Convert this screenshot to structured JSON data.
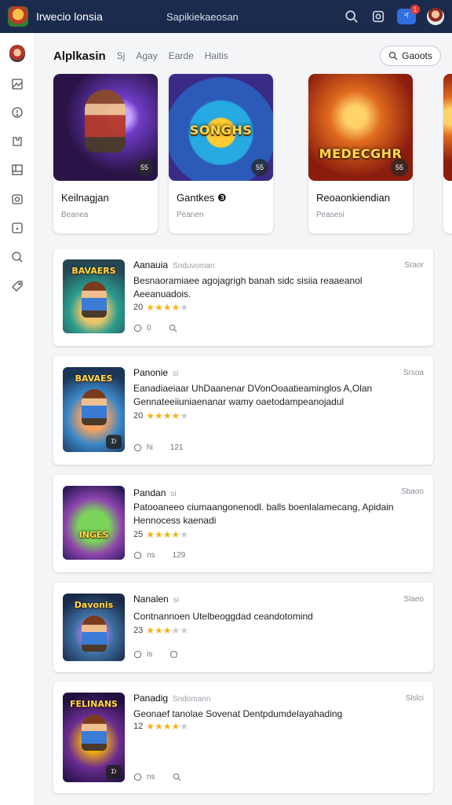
{
  "header": {
    "app_title": "Irwecio lonsia",
    "search_text": "Sapikiekaeosan",
    "notification_label": "ণ",
    "notification_count": "1"
  },
  "sidebar": {
    "items": [
      "profile",
      "image-icon",
      "alert-icon",
      "puzzle-icon",
      "layout-icon",
      "camera-icon",
      "help-icon",
      "search-icon",
      "tag-icon"
    ]
  },
  "tabs": [
    "Alplkasin",
    "Sj",
    "Agay",
    "Earde",
    "Haitis"
  ],
  "filter_button": "Gaoots",
  "featured": [
    {
      "name": "Keilnagjan",
      "sub": "Beanea",
      "badge": "55"
    },
    {
      "name": "Gantkes ❸",
      "sub": "Peanen",
      "art_title": "SONGHS",
      "badge": "55"
    },
    {
      "name": "Reoaonkiendian",
      "sub": "Peasesi",
      "art_title": "MEDECGHR",
      "badge": "55"
    }
  ],
  "rows": [
    {
      "title": "Aanauia",
      "subtitle": "Snduvoman",
      "date": "Sraor",
      "desc": "Besnaoramiaee agojagrigh banah sidc sisiia reaaeanol",
      "desc2": "Aeeanuadois.",
      "rating": "20",
      "stars": 4,
      "meta1": "0",
      "meta2": "",
      "art_title": "BAVAERS"
    },
    {
      "title": "Panonie",
      "subtitle": "si",
      "date": "Srsoa",
      "desc": "Eanadiaeiaar UhDaanenar DVonOoaatieaminglos A,Olan",
      "desc2": "Gennateeiiuniaenanar wamy oaetodampeanojadul",
      "rating": "20",
      "stars": 4,
      "meta1": "hi",
      "meta2": "121",
      "art_title": "BAVAES"
    },
    {
      "title": "Pandan",
      "subtitle": "si",
      "date": "Sbaoo",
      "desc": "Patooaneeo ciumaangonenodl. balls boenlalamecang, Apidain",
      "desc2": "Hennocess kaenadi",
      "rating": "25",
      "stars": 4,
      "meta1": "ns",
      "meta2": "129",
      "art_title": "INGES"
    },
    {
      "title": "Nanalen",
      "subtitle": "si",
      "date": "Slaeo",
      "desc": "Contnannoen Utelbeoggdad ceandotomind",
      "desc2": "",
      "rating": "23",
      "stars": 3,
      "meta1": "is",
      "meta2": "",
      "art_title": "Davonis"
    },
    {
      "title": "Panadig",
      "subtitle": "Sndomann",
      "date": "Slslci",
      "desc": "Geonaef tanolae Sovenat Dentpdumdelayahading",
      "desc2": "",
      "rating": "12",
      "stars": 4,
      "meta1": "ns",
      "meta2": "",
      "art_title": "FELINANS"
    }
  ]
}
